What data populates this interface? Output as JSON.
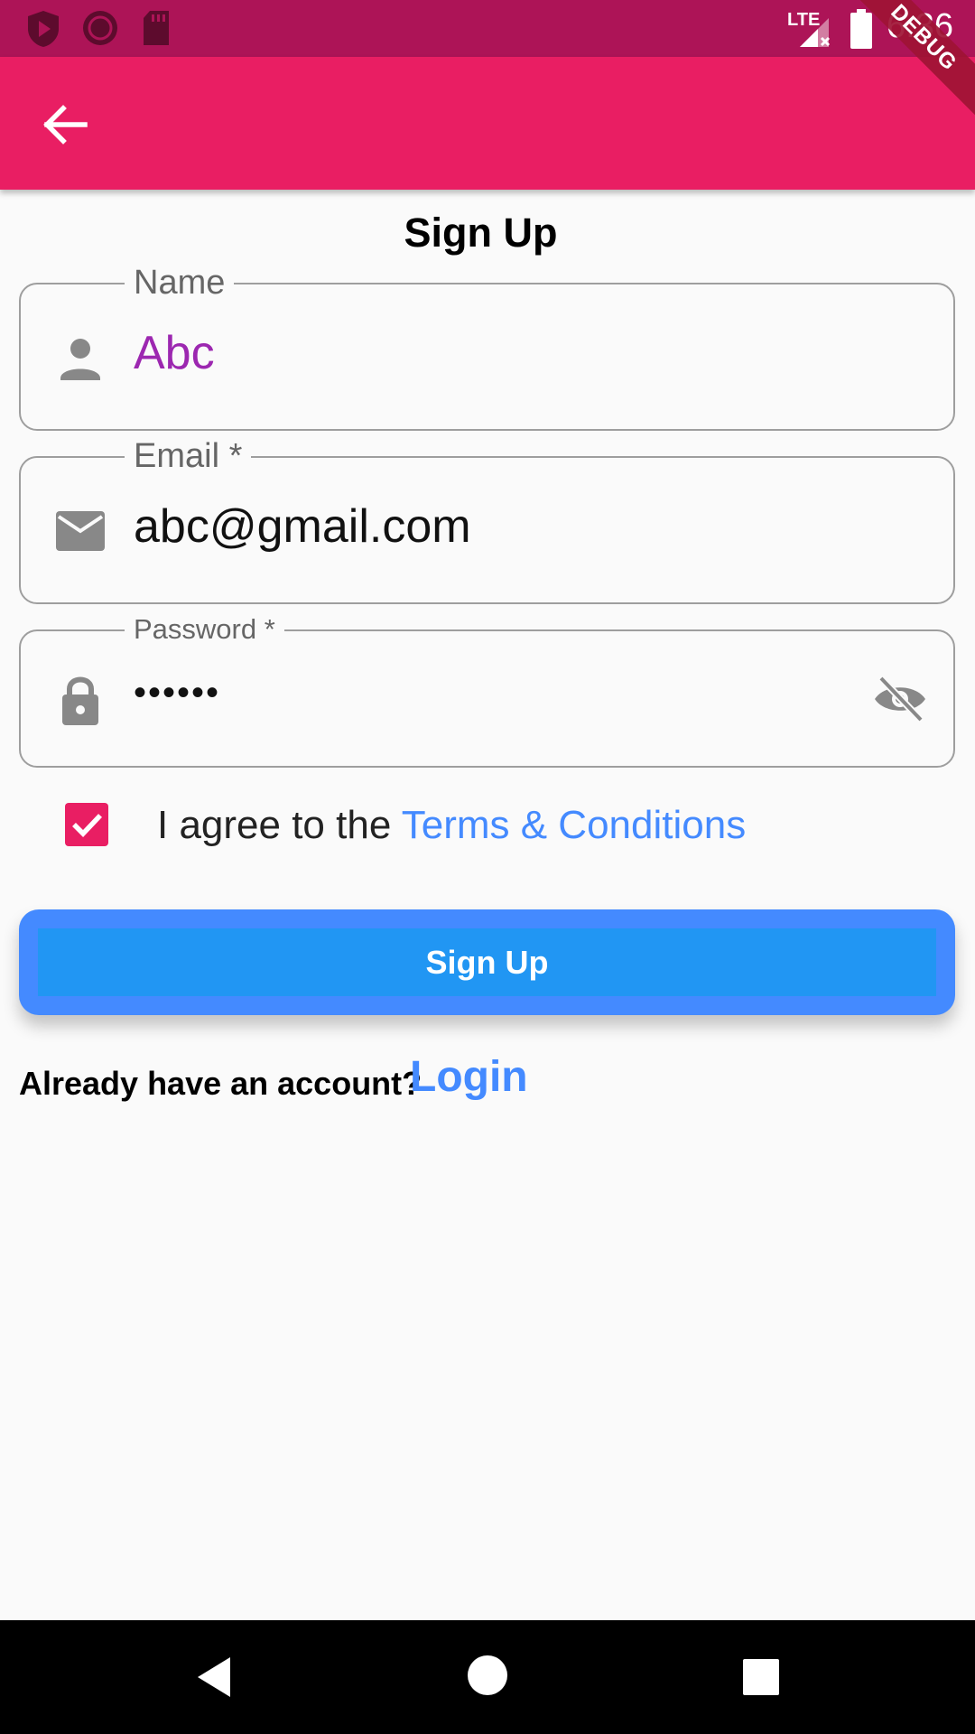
{
  "status_bar": {
    "time": "6:36",
    "network": "LTE",
    "left_icons": [
      "shield-play-icon",
      "record-circle-icon",
      "sd-card-icon"
    ],
    "right_icons": [
      "lte-signal-icon",
      "battery-icon"
    ],
    "color": "#ad1457"
  },
  "debug_banner": "DEBUG",
  "app_bar": {
    "back_icon": "arrow-back-icon",
    "color": "#e91e63"
  },
  "page": {
    "title": "Sign Up"
  },
  "form": {
    "name": {
      "label": "Name",
      "value": "Abc",
      "icon": "person-icon"
    },
    "email": {
      "label": "Email *",
      "value": "abc@gmail.com",
      "icon": "mail-icon"
    },
    "password": {
      "label": "Password *",
      "value": "••••••",
      "icon": "lock-icon",
      "toggle_icon": "visibility-off-icon"
    }
  },
  "terms": {
    "checked": true,
    "prefix": "I agree to the ",
    "link": "Terms & Conditions"
  },
  "signup_button": {
    "label": "Sign Up",
    "color": "#2196f3",
    "outer_color": "#448aff"
  },
  "login": {
    "prompt": "Already have an account?",
    "link": "Login",
    "link_color": "#448aff"
  },
  "nav_bar": {
    "buttons": [
      "back-triangle-icon",
      "home-circle-icon",
      "recents-square-icon"
    ]
  }
}
